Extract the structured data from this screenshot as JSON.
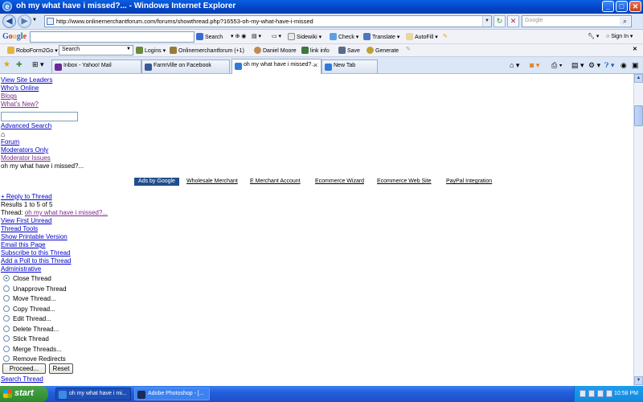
{
  "browser": {
    "window_title": "oh my what have i missed?... - Windows Internet Explorer",
    "url": "http://www.onlinemerchantforum.com/forums/showthread.php?16553-oh-my-what-have-i-missed",
    "search_placeholder": "Google",
    "icons": [
      "back-icon",
      "forward-icon",
      "refresh-icon",
      "stop-icon",
      "search-icon"
    ]
  },
  "google_toolbar": {
    "logo_letters": [
      "G",
      "o",
      "o",
      "g",
      "l",
      "e"
    ],
    "search_button": "Search",
    "sidewiki": "Sidewiki",
    "check": "Check",
    "translate": "Translate",
    "autofill": "AutoFill",
    "signin": "Sign In"
  },
  "roboform_toolbar": {
    "roboform": "RoboForm2Go",
    "search_text": "Search",
    "logins": "Logins",
    "forum": "Onlinemerchantforum (+1)",
    "user": "Daniel Moore",
    "link_info": "link info",
    "save": "Save",
    "generate": "Generate"
  },
  "tabs": [
    {
      "label": "Inbox - Yahoo! Mail",
      "icon_color": "#6b2a9a"
    },
    {
      "label": "FarmVille on Facebook",
      "icon_color": "#3b5998"
    },
    {
      "label": "oh my what have i missed?...",
      "icon_color": "#2f7bd8"
    },
    {
      "label": "New Tab",
      "icon_color": "#2f7bd8"
    }
  ],
  "page": {
    "links_top": [
      "View Site Leaders",
      "Who's Online",
      "Blogs",
      "What's New?"
    ],
    "advanced_search": "Advanced Search",
    "breadcrumbs": [
      "Forum",
      "Moderators Only",
      "Moderator Issues"
    ],
    "thread_title": "oh my what have i missed?...",
    "ads_label": "Ads by Google",
    "ads": [
      "Wholesale Merchant",
      "E Merchant Account",
      "Ecommerce Wizard",
      "Ecommerce Web Site",
      "PayPal Integration"
    ],
    "reply": "+ Reply to Thread",
    "results": "Results 1 to 5 of 5",
    "thread_label": "Thread:",
    "thread_link": "oh my what have i missed?...",
    "thread_links": [
      "View First Unread",
      "Thread Tools",
      "Show Printable Version",
      "Email this Page",
      "Subscribe to this Thread",
      "Add a Poll to this Thread",
      "Administrative"
    ],
    "admin_options": [
      "Close Thread",
      "Unapprove Thread",
      "Move Thread...",
      "Copy Thread...",
      "Edit Thread...",
      "Delete Thread...",
      "Stick Thread",
      "Merge Threads...",
      "Remove Redirects"
    ],
    "selected_option": "Close Thread",
    "proceed": "Proceed...",
    "reset": "Reset",
    "search_thread": "Search Thread"
  },
  "taskbar": {
    "start": "start",
    "items": [
      "oh my what have i mi...",
      "Adobe Photoshop - [..."
    ],
    "clock": "10:58 PM"
  }
}
